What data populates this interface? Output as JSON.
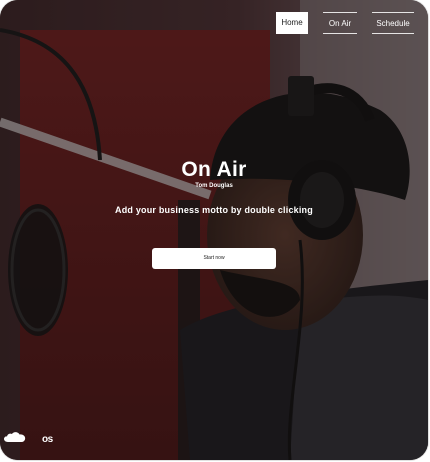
{
  "nav": {
    "items": [
      {
        "label": "Home"
      },
      {
        "label": "On Air"
      },
      {
        "label": "Schedule"
      }
    ]
  },
  "hero": {
    "title": "On Air",
    "subtitle": "Tom Douglas",
    "motto": "Add your business motto by double clicking",
    "cta_label": "Start now",
    "image": "radio-host-at-microphone-photo"
  },
  "social": {
    "icons": [
      "soundcloud-icon",
      "lastfm-icon"
    ],
    "lastfm_glyph": "os"
  },
  "colors": {
    "overlay": "#1a1112",
    "backdrop_red": "#6b1c1c",
    "text": "#ffffff"
  }
}
